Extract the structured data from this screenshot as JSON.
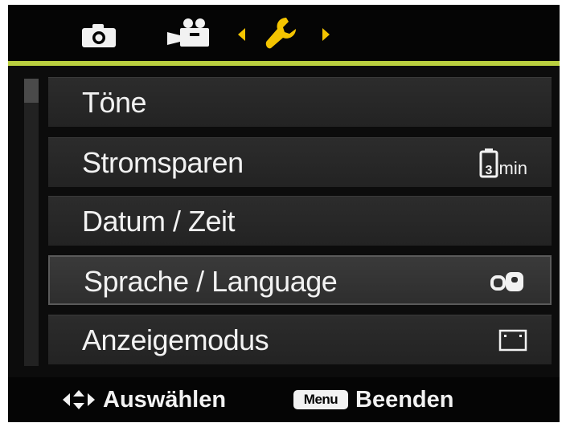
{
  "tabs": [
    {
      "name": "camera-icon",
      "active": false
    },
    {
      "name": "video-icon",
      "active": false
    },
    {
      "name": "wrench-icon",
      "active": true
    }
  ],
  "colors": {
    "accent_line": "#b9cf3f",
    "active_tab": "#f4c400",
    "text": "#f2f2f2",
    "background": "#0c0c0c"
  },
  "menu": {
    "items": [
      {
        "label": "Töne",
        "value_icon": null
      },
      {
        "label": "Stromsparen",
        "value_icon": "battery-3min-icon",
        "value_text": "min"
      },
      {
        "label": "Datum / Zeit",
        "value_icon": null
      },
      {
        "label": "Sprache / Language",
        "value_icon": "language-icon"
      },
      {
        "label": "Anzeigemodus",
        "value_icon": "display-mode-icon"
      }
    ],
    "selected_index": 3
  },
  "footer": {
    "select_label": "Auswählen",
    "menu_badge": "Menu",
    "exit_label": "Beenden"
  }
}
